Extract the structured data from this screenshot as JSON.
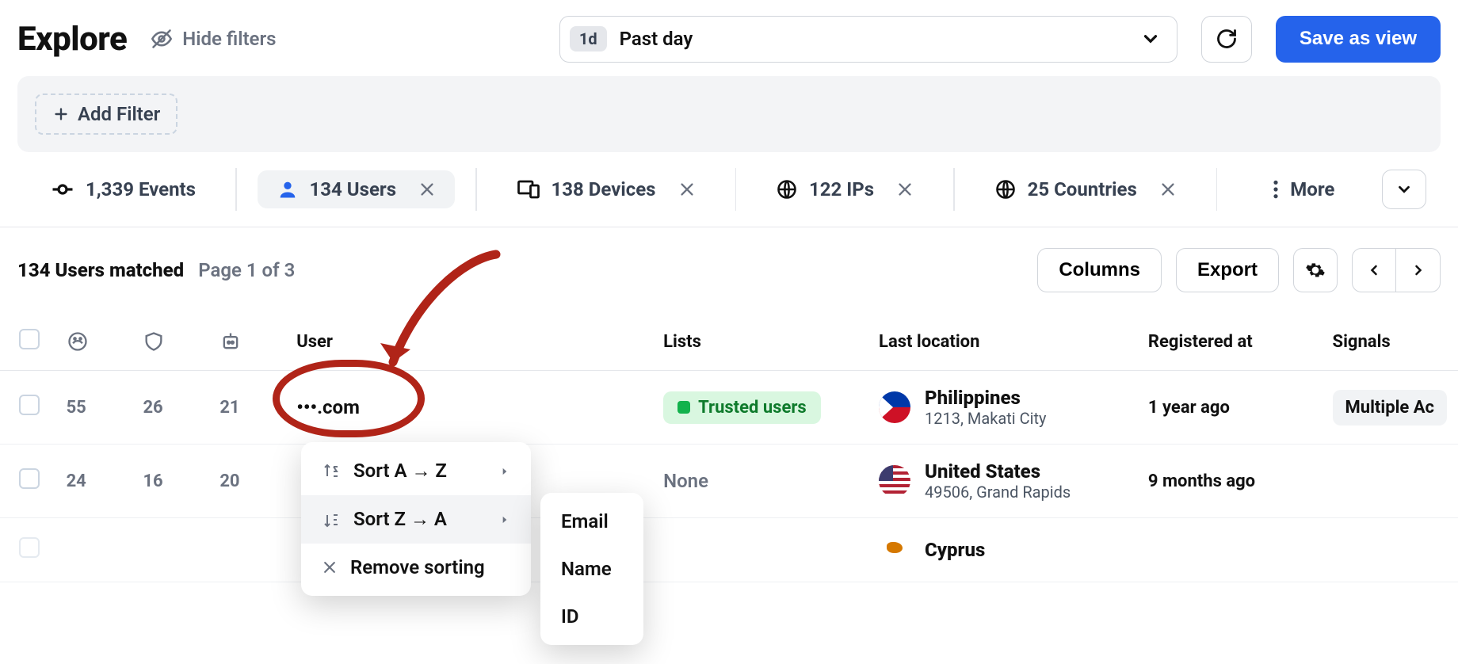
{
  "header": {
    "title": "Explore",
    "hide_filters": "Hide filters",
    "range_badge": "1d",
    "range_label": "Past day",
    "save_view": "Save as view"
  },
  "filters": {
    "add_label": "Add Filter"
  },
  "segments": {
    "events": "1,339 Events",
    "users": "134 Users",
    "devices": "138 Devices",
    "ips": "122 IPs",
    "countries": "25 Countries",
    "more": "More"
  },
  "results": {
    "matched": "134 Users matched",
    "page": "Page 1 of 3",
    "columns_btn": "Columns",
    "export_btn": "Export"
  },
  "table": {
    "headers": {
      "user": "User",
      "lists": "Lists",
      "last_location": "Last location",
      "registered_at": "Registered at",
      "signals": "Signals"
    },
    "rows": [
      {
        "n1": "55",
        "n2": "26",
        "n3": "21",
        "user": "•••.com",
        "list": "Trusted users",
        "country": "Philippines",
        "sub": "1213, Makati City",
        "flag": "ph",
        "registered": "1 year ago",
        "signal": "Multiple Ac"
      },
      {
        "n1": "24",
        "n2": "16",
        "n3": "20",
        "user": "",
        "list": "None",
        "country": "United States",
        "sub": "49506, Grand Rapids",
        "flag": "us",
        "registered": "9 months ago",
        "signal": ""
      },
      {
        "n1": "",
        "n2": "",
        "n3": "",
        "user": "",
        "list": "",
        "country": "Cyprus",
        "sub": "",
        "flag": "cy",
        "registered": "",
        "signal": ""
      }
    ]
  },
  "sort_menu": {
    "az": "Sort A → Z",
    "za": "Sort Z → A",
    "remove": "Remove sorting"
  },
  "sort_sub": {
    "email": "Email",
    "name": "Name",
    "id": "ID"
  }
}
